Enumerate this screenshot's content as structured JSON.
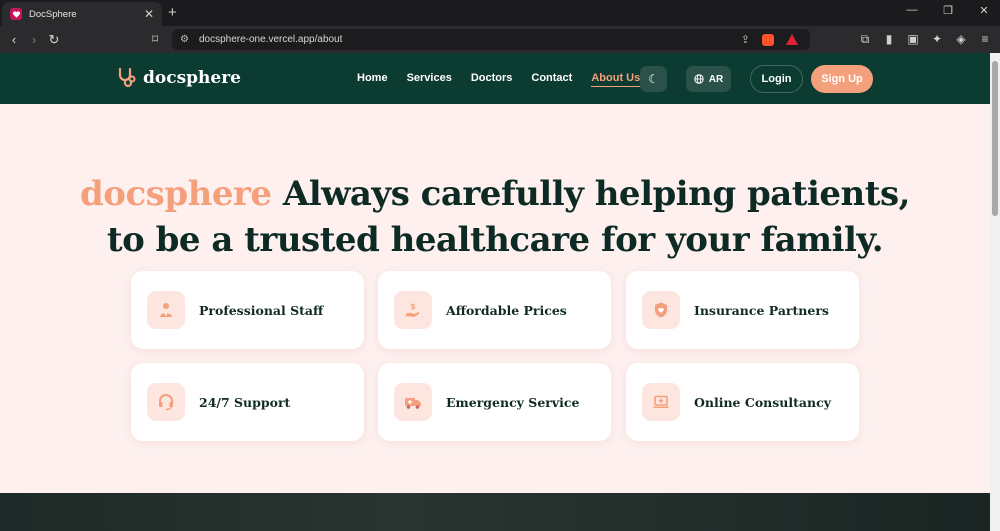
{
  "browser": {
    "tab_title": "DocSphere",
    "new_tab": "+",
    "url": "docsphere-one.vercel.app/about"
  },
  "site": {
    "logo_text": "docsphere",
    "nav": [
      "Home",
      "Services",
      "Doctors",
      "Contact",
      "About Us"
    ],
    "active_nav": "About Us",
    "lang_label": "AR",
    "login_label": "Login",
    "signup_label": "Sign Up"
  },
  "hero": {
    "brand": "docsphere",
    "title_line1_rest": " Always carefully helping patients,",
    "title_line2": "to be a trusted healthcare for your family."
  },
  "features": [
    {
      "label": "Professional Staff",
      "icon": "doctor-icon"
    },
    {
      "label": "Affordable Prices",
      "icon": "hand-dollar-icon"
    },
    {
      "label": "Insurance Partners",
      "icon": "shield-heart-icon"
    },
    {
      "label": "24/7 Support",
      "icon": "headset-icon"
    },
    {
      "label": "Emergency Service",
      "icon": "ambulance-icon"
    },
    {
      "label": "Online Consultancy",
      "icon": "laptop-medical-icon"
    }
  ],
  "colors": {
    "nav_bg": "#0c3b32",
    "accent": "#f4a07d",
    "page_bg": "#fdf0ef",
    "heading": "#0d2b24"
  }
}
